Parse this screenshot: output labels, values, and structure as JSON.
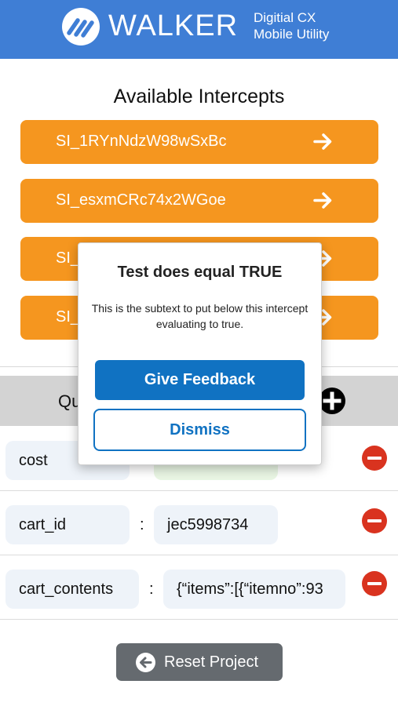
{
  "header": {
    "brand": "WALKER",
    "subtitle_line1": "Digitial CX",
    "subtitle_line2": "Mobile Utility"
  },
  "intercepts": {
    "title": "Available Intercepts",
    "items": [
      {
        "label": "SI_1RYnNdzW98wSxBc"
      },
      {
        "label": "SI_esxmCRc74x2WGoe"
      },
      {
        "label": "SI_"
      },
      {
        "label": "SI_"
      }
    ]
  },
  "query_params": {
    "title": "Qu",
    "rows": [
      {
        "key": "cost",
        "value": ""
      },
      {
        "key": "cart_id",
        "value": "jec5998734"
      },
      {
        "key": "cart_contents",
        "value": "{“items”:[{“itemno”:93"
      }
    ]
  },
  "footer": {
    "reset_label": "Reset Project"
  },
  "dialog": {
    "title": "Test does equal TRUE",
    "subtext": "This is the subtext to put below this intercept evaluating to true.",
    "feedback_label": "Give Feedback",
    "dismiss_label": "Dismiss"
  },
  "colors": {
    "header_bg": "#3f7ed5",
    "intercept_button": "#f5961f",
    "primary_blue": "#1072c2",
    "remove_red": "#d9331f",
    "reset_gray": "#656a6f"
  },
  "icons": [
    "walker-logo-icon",
    "arrow-right-icon",
    "plus-circle-icon",
    "minus-circle-icon",
    "arrow-left-circle-icon"
  ]
}
